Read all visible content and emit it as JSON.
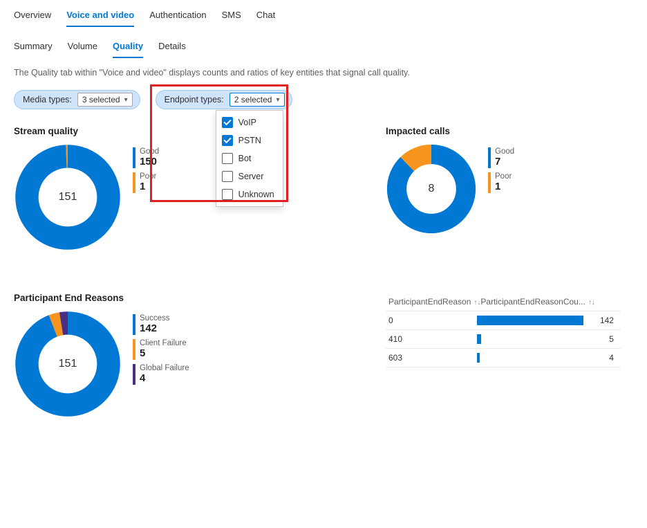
{
  "tabs": [
    "Overview",
    "Voice and video",
    "Authentication",
    "SMS",
    "Chat"
  ],
  "activeTab": 1,
  "subtabs": [
    "Summary",
    "Volume",
    "Quality",
    "Details"
  ],
  "activeSubtab": 2,
  "description": "The Quality tab within \"Voice and video\" displays counts and ratios of key entities that signal call quality.",
  "filters": {
    "media": {
      "label": "Media types:",
      "value": "3 selected"
    },
    "endpoint": {
      "label": "Endpoint types:",
      "value": "2 selected",
      "options": [
        {
          "label": "VoIP",
          "checked": true
        },
        {
          "label": "PSTN",
          "checked": true
        },
        {
          "label": "Bot",
          "checked": false
        },
        {
          "label": "Server",
          "checked": false
        },
        {
          "label": "Unknown",
          "checked": false
        }
      ]
    }
  },
  "chart_data": [
    {
      "id": "stream_quality",
      "title": "Stream quality",
      "type": "pie",
      "total": 151,
      "series": [
        {
          "name": "Good",
          "value": 150,
          "color": "#0078d4"
        },
        {
          "name": "Poor",
          "value": 1,
          "color": "#f7941d"
        }
      ]
    },
    {
      "id": "impacted_calls",
      "title": "Impacted calls",
      "type": "pie",
      "total": 8,
      "series": [
        {
          "name": "Good",
          "value": 7,
          "color": "#0078d4"
        },
        {
          "name": "Poor",
          "value": 1,
          "color": "#f7941d"
        }
      ]
    },
    {
      "id": "participant_end_reasons",
      "title": "Participant End Reasons",
      "type": "pie",
      "total": 151,
      "series": [
        {
          "name": "Success",
          "value": 142,
          "color": "#0078d4"
        },
        {
          "name": "Client Failure",
          "value": 5,
          "color": "#f7941d"
        },
        {
          "name": "Global Failure",
          "value": 4,
          "color": "#4b2e83"
        }
      ]
    },
    {
      "id": "end_reason_table",
      "type": "table",
      "columns": [
        "ParticipantEndReason",
        "ParticipantEndReasonCou..."
      ],
      "rows": [
        {
          "reason": "0",
          "count": 142
        },
        {
          "reason": "410",
          "count": 5
        },
        {
          "reason": "603",
          "count": 4
        }
      ],
      "max": 142
    }
  ]
}
